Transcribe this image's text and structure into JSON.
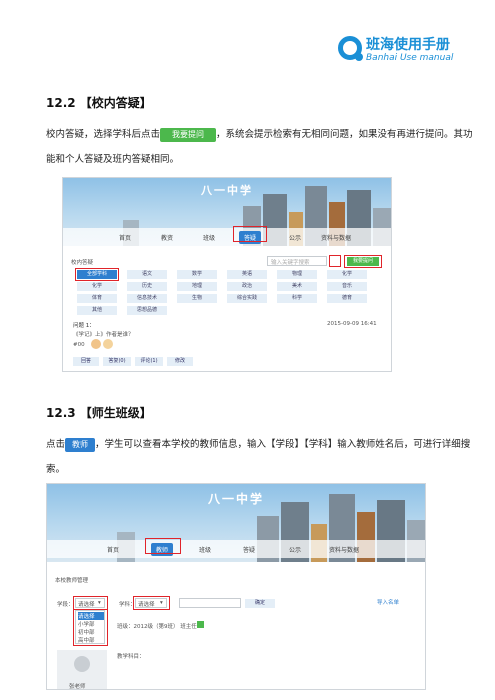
{
  "logo": {
    "cn": "班海使用手册",
    "en": "Banhai Use manual",
    "icon": "banhai-logo-icon"
  },
  "section1": {
    "heading": "12.2 【校内答疑】",
    "text_before": "校内答疑，选择学科后点击",
    "button": "我要提问",
    "text_after": "，系统会提示检索有无相同问题，如果没有再进行提问。其功",
    "line2": "能和个人答疑及班内答疑相同。"
  },
  "shot1": {
    "school": "八一中学",
    "nav": [
      "首页",
      "教资",
      "班级",
      "答疑",
      "公示",
      "资料与数据"
    ],
    "active_nav": "答疑",
    "panel_title": "校内答疑",
    "search_placeholder": "输入关键字搜索",
    "ask_button": "我要提问",
    "subjects": [
      "全部学科",
      "语文",
      "数学",
      "英语",
      "物理",
      "化学",
      "化学",
      "历史",
      "地理",
      "政治",
      "美术",
      "音乐",
      "体育",
      "信息技术",
      "生物",
      "综合实践",
      "科学",
      "德育",
      "其他",
      "思想品德"
    ],
    "question_title": "问题 1：",
    "question_time": "2015-09-09 16:41",
    "question_text": "《学记》上》作者是谁？",
    "question_meta": "#00",
    "actions": [
      "回答",
      "答复(0)",
      "评论(1)",
      "修改"
    ]
  },
  "section2": {
    "heading": "12.3 【师生班级】",
    "text_before": "点击",
    "button": "教师",
    "text_after": "，学生可以查看本学校的教师信息，输入【学段】【学科】输入教师姓名后，可进行详细搜",
    "line2": "索。"
  },
  "shot2": {
    "school": "八一中学",
    "nav": [
      "首页",
      "教师",
      "班级",
      "答疑",
      "公示",
      "资料与数据"
    ],
    "active_nav": "教师",
    "panel_title": "本校教师管理",
    "stage_label": "学段：",
    "stage_value": "请选择",
    "stage_options": [
      "请选择",
      "小学部",
      "初中部",
      "高中部"
    ],
    "subject_label": "学科：",
    "subject_value": "请选择",
    "confirm": "确定",
    "link": "导入名单",
    "teacher_line": "班级：2012级（第9班） 班主任",
    "teacher_subject": "教学科目：",
    "teacher_name": "张老师"
  }
}
